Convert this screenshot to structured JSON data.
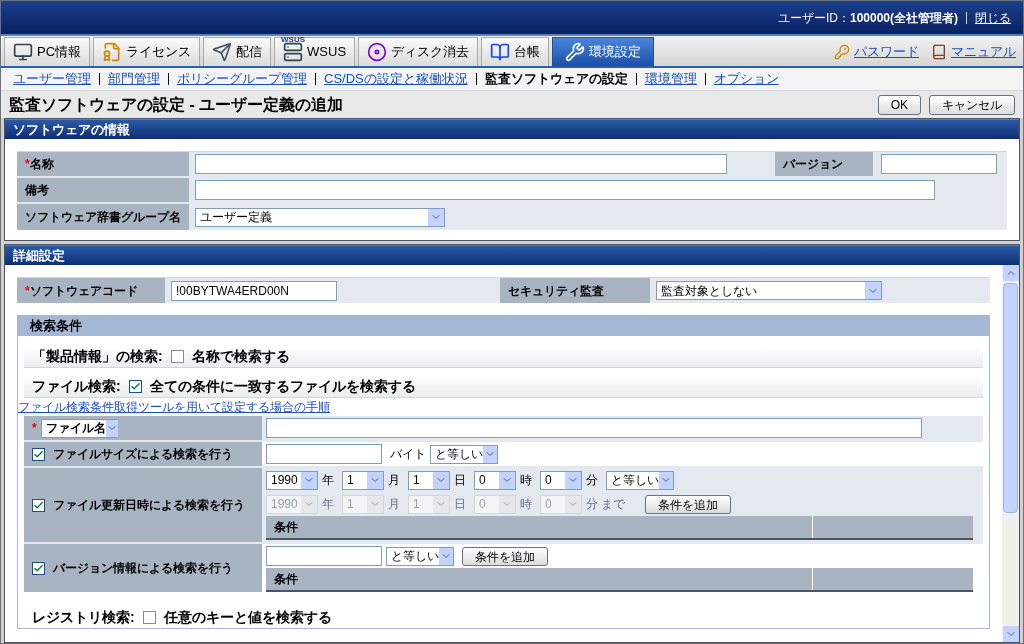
{
  "header": {
    "user_label": "ユーザーID：",
    "user_value": "100000(全社管理者)",
    "close_link": "閉じる"
  },
  "tabs": [
    {
      "kind": "pc",
      "label": "PC情報",
      "selected": false
    },
    {
      "kind": "license",
      "label": "ライセンス",
      "selected": false
    },
    {
      "kind": "deliver",
      "label": "配信",
      "selected": false
    },
    {
      "kind": "wsus",
      "label": "WSUS",
      "badge": "WSUS",
      "selected": false
    },
    {
      "kind": "disk",
      "label": "ディスク消去",
      "selected": false
    },
    {
      "kind": "ledger",
      "label": "台帳",
      "selected": false
    },
    {
      "kind": "settings",
      "label": "環境設定",
      "selected": true
    }
  ],
  "right_links": [
    {
      "kind": "key",
      "label": "パスワード"
    },
    {
      "kind": "book",
      "label": "マニュアル"
    }
  ],
  "subnav": [
    {
      "label": "ユーザー管理",
      "selected": false
    },
    {
      "label": "部門管理",
      "selected": false
    },
    {
      "label": "ポリシーグループ管理",
      "selected": false
    },
    {
      "label": "CS/DSの設定と稼働状況",
      "selected": false
    },
    {
      "label": "監査ソフトウェアの設定",
      "selected": true
    },
    {
      "label": "環境管理",
      "selected": false
    },
    {
      "label": "オプション",
      "selected": false
    }
  ],
  "page_title": "監査ソフトウェアの設定 - ユーザー定義の追加",
  "buttons": [
    "OK",
    "キャンセル"
  ],
  "software_info": {
    "title": "ソフトウェアの情報",
    "required_mark": "*",
    "name_label": "名称",
    "version_label": "バージョン",
    "remarks_label": "備考",
    "group_label": "ソフトウェア辞書グループ名",
    "group_value": "ユーザー定義"
  },
  "details": {
    "title": "詳細設定",
    "required_mark": "*",
    "code_label": "ソフトウェアコード",
    "code_value": "!00BYTWA4ERD00N",
    "security_label": "セキュリティ監査",
    "security_value": "監査対象としない",
    "conditions_title": "検索条件",
    "product_search": {
      "label": "「製品情報」の検索:",
      "checkbox_label": "名称で検索する",
      "checked": false
    },
    "file_search": {
      "label": "ファイル検索:",
      "checkbox_label": "全ての条件に一致するファイルを検索する",
      "checked": true
    },
    "help_link": "ファイル検索条件取得ツールを用いて設定する場合の手順",
    "filename_mark": "*",
    "filename_select": "ファイル名",
    "size": {
      "checked": true,
      "label": "ファイルサイズによる検索を行う",
      "unit": "バイト",
      "op": "と等しい"
    },
    "date": {
      "checked": true,
      "label": "ファイル更新日時による検索を行う",
      "rows": [
        {
          "disabled": false,
          "values": [
            "1990",
            "1",
            "1",
            "0",
            "0"
          ],
          "units": [
            "年",
            "月",
            "日",
            "時",
            "分"
          ],
          "op": "と等しい"
        },
        {
          "disabled": true,
          "values": [
            "1990",
            "1",
            "1",
            "0",
            "0"
          ],
          "units": [
            "年",
            "月",
            "日",
            "時",
            "分 まで"
          ]
        }
      ],
      "add_button": "条件を追加",
      "table_header": "条件"
    },
    "version": {
      "checked": true,
      "label": "バージョン情報による検索を行う",
      "op": "と等しい",
      "add_button": "条件を追加",
      "table_header": "条件"
    },
    "registry": {
      "label": "レジストリ検索:",
      "checkbox_label": "任意のキーと値を検索する",
      "checked": false
    }
  }
}
